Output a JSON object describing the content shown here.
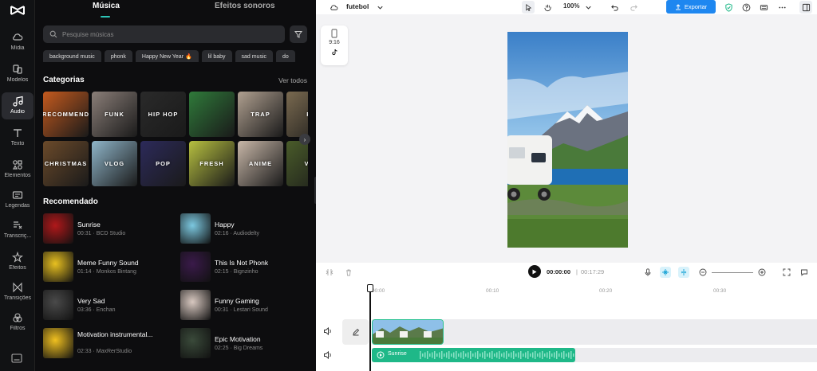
{
  "rail": {
    "items": [
      {
        "label": "Mídia",
        "icon": "cloud-icon"
      },
      {
        "label": "Modelos",
        "icon": "templates-icon"
      },
      {
        "label": "Áudio",
        "icon": "music-note-icon",
        "active": true
      },
      {
        "label": "Texto",
        "icon": "text-icon"
      },
      {
        "label": "Elementos",
        "icon": "elements-icon"
      },
      {
        "label": "Legendas",
        "icon": "captions-icon"
      },
      {
        "label": "Transcriç...",
        "icon": "transcription-icon"
      },
      {
        "label": "Efeitos",
        "icon": "effects-icon"
      },
      {
        "label": "Transições",
        "icon": "transitions-icon"
      },
      {
        "label": "Filtros",
        "icon": "filters-icon"
      }
    ]
  },
  "panel": {
    "tabs": {
      "music": "Música",
      "effects": "Efeitos sonoros"
    },
    "search": {
      "placeholder": "Pesquise músicas"
    },
    "chips": [
      "background music",
      "phonk",
      "Happy New Year 🔥",
      "lil baby",
      "sad music",
      "do"
    ],
    "categories_title": "Categorias",
    "see_all": "Ver todos",
    "categories": [
      {
        "label": "RECOMMEND",
        "color": "#c45a1e"
      },
      {
        "label": "FUNK",
        "color": "#8a7e78"
      },
      {
        "label": "HIP HOP",
        "color": "#2a2a2a"
      },
      {
        "label": "",
        "color": "#2f7a3a"
      },
      {
        "label": "TRAP",
        "color": "#b0a090"
      },
      {
        "label": "R",
        "color": "#7a6a50"
      },
      {
        "label": "CHRISTMAS",
        "color": "#6b4a2a"
      },
      {
        "label": "VLOG",
        "color": "#8fb5c9"
      },
      {
        "label": "POP",
        "color": "#2c2a5a"
      },
      {
        "label": "FRESH",
        "color": "#b7c040"
      },
      {
        "label": "ANIME",
        "color": "#c8b7a8"
      },
      {
        "label": "VE",
        "color": "#4a5c2a"
      }
    ],
    "recommended_title": "Recomendado",
    "recommended": [
      {
        "title": "Sunrise",
        "meta": "00:31 · BCD Studio",
        "color": "#b0181a"
      },
      {
        "title": "Happy",
        "meta": "02:16 · Audiodelty",
        "color": "#7cc8e0"
      },
      {
        "title": "Meme Funny Sound",
        "meta": "01:14 · Monkos Bintang",
        "color": "#e8c020"
      },
      {
        "title": "This Is Not Phonk",
        "meta": "02:15 · Bignzinho",
        "color": "#3a1a4a"
      },
      {
        "title": "Very Sad",
        "meta": "03:36 · Enchan",
        "color": "#4a4a4a"
      },
      {
        "title": "Funny Gaming",
        "meta": "00:31 · Lestari Sound",
        "color": "#d8c8c0"
      },
      {
        "title": "Motivation instrumental...",
        "meta": "02:33 · MaxRerStudio",
        "color": "#f0c020"
      },
      {
        "title": "Epic Motivation",
        "meta": "02:25 · Big Dreams",
        "color": "#3a4a3a"
      }
    ]
  },
  "editor": {
    "project_name": "futebol",
    "zoom": "100%",
    "export_label": "Exportar",
    "ratio": "9:16",
    "time_current": "00:00:00",
    "time_sep": "|",
    "time_total": "00:17:29",
    "ruler_marks": [
      "00:00",
      "00:10",
      "00:20",
      "00:30"
    ],
    "audio_clip_label": "Sunrise",
    "accent_color": "#1fb888",
    "export_color": "#1e87f0"
  }
}
